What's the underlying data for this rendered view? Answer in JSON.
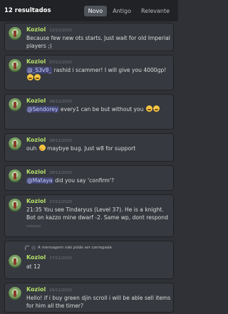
{
  "header": {
    "result_count": "12 resultados",
    "tabs": [
      {
        "label": "Novo",
        "active": true
      },
      {
        "label": "Antigo",
        "active": false
      },
      {
        "label": "Relevante",
        "active": false
      }
    ]
  },
  "author_color": "#b5e06a",
  "messages": [
    {
      "author": "Koziol",
      "date": "12/12/2020",
      "text": "Because few new ots starts. Just wait for old Imperial players ;)"
    },
    {
      "author": "Koziol",
      "date": "07/12/2020",
      "mention": "@_S3v9_",
      "text": " rashid i scammer! I will give you 4000gp!",
      "emojis": [
        "face-with-tears-of-joy",
        "face-with-tears-of-joy"
      ]
    },
    {
      "author": "Koziol",
      "date": "06/12/2020",
      "mention": "@Sendorey",
      "text": " every1 can be but without you",
      "emojis": [
        "face-with-tears-of-joy",
        "face-with-tears-of-joy"
      ]
    },
    {
      "author": "Koziol",
      "date": "28/11/2020",
      "text": "ouh",
      "after": " maybye bug. Just w8 for support",
      "emojis": [
        "thinking-face"
      ]
    },
    {
      "author": "Koziol",
      "date": "28/11/2020",
      "mention": "@Mataya",
      "text": " did you say 'confirm'?"
    },
    {
      "author": "Koziol",
      "date": "27/11/2020",
      "text": "21:35 You see Tindaryus (Level 37). He is a knight. Bot on kazzo mine dwarf -2. Same wp, dont respond",
      "edited": "(editado)"
    },
    {
      "reply_note": "A mensagem não pôde ser carregada.",
      "author": "Koziol",
      "date": "27/11/2020",
      "text": "at 12"
    },
    {
      "author": "Koziol",
      "date": "24/11/2020",
      "text": "Hello! if i buy green djin scroll i will be able sell items for him all the timer?"
    }
  ]
}
